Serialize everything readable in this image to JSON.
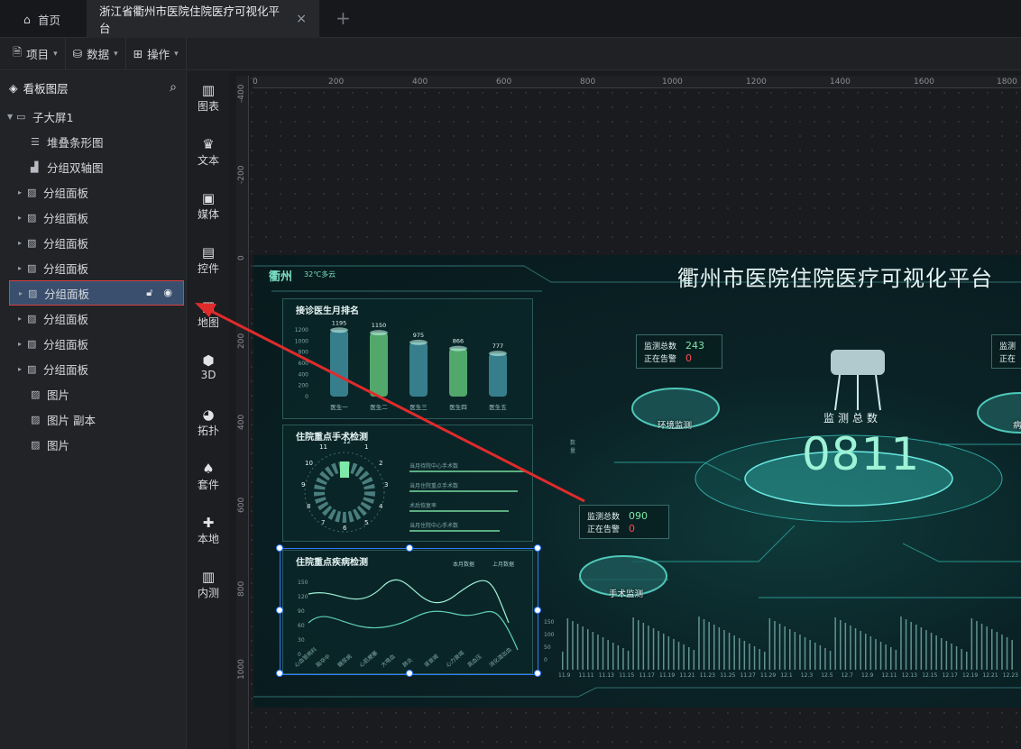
{
  "tabs": {
    "home_label": "首页",
    "active_label": "浙江省衢州市医院住院医疗可视化平台",
    "close": "×",
    "add": "+"
  },
  "toolbar": {
    "project_label": "项目",
    "data_label": "数据",
    "operate_label": "操作"
  },
  "layers": {
    "title": "看板图层",
    "root_label": "子大屏1",
    "items": [
      {
        "label": "堆叠条形图",
        "icon": "stacked-bar-icon"
      },
      {
        "label": "分组双轴图",
        "icon": "dual-axis-icon"
      },
      {
        "label": "分组面板",
        "icon": "group-panel-icon"
      },
      {
        "label": "分组面板",
        "icon": "group-panel-icon"
      },
      {
        "label": "分组面板",
        "icon": "group-panel-icon"
      },
      {
        "label": "分组面板",
        "icon": "group-panel-icon"
      },
      {
        "label": "分组面板",
        "icon": "group-panel-icon",
        "selected": true
      },
      {
        "label": "分组面板",
        "icon": "group-panel-icon"
      },
      {
        "label": "分组面板",
        "icon": "group-panel-icon"
      },
      {
        "label": "分组面板",
        "icon": "group-panel-icon"
      },
      {
        "label": "图片",
        "icon": "image-icon"
      },
      {
        "label": "图片 副本",
        "icon": "image-icon"
      },
      {
        "label": "图片",
        "icon": "image-icon"
      }
    ]
  },
  "components": [
    "图表",
    "文本",
    "媒体",
    "控件",
    "地图",
    "3D",
    "拓扑",
    "套件",
    "本地",
    "内测"
  ],
  "ruler": {
    "top": [
      "0",
      "200",
      "400",
      "600",
      "800",
      "1000",
      "1200",
      "1400",
      "1600",
      "1800"
    ],
    "left": [
      "-400",
      "-200",
      "0",
      "200",
      "400",
      "600",
      "800",
      "1000"
    ]
  },
  "dashboard": {
    "city": "衢州",
    "weather": "32℃多云",
    "title": "衢州市医院住院医疗可视化平台",
    "doctor_panel": {
      "title": "接诊医生月排名",
      "y_ticks": [
        "1200",
        "1000",
        "800",
        "600",
        "400",
        "200",
        "0"
      ]
    },
    "surgery_panel": {
      "title": "住院重点手术检测",
      "clock": [
        "12",
        "1",
        "2",
        "3",
        "4",
        "5",
        "6",
        "7",
        "8",
        "9",
        "10",
        "11"
      ],
      "bar_labels": [
        "当月待院中心手术数",
        "当月住院重点手术数",
        "术后恢复率",
        "当月住院中心手术数",
        "数量"
      ]
    },
    "disease_panel": {
      "title": "住院重点疾病检测",
      "legend": [
        "本月数据",
        "上月数据"
      ],
      "y_ticks": [
        "150",
        "120",
        "90",
        "60",
        "30",
        "0"
      ],
      "x_labels": [
        "心血管病科",
        "脑卒中",
        "糖尿病",
        "心肌梗塞",
        "大咯血",
        "肺炎",
        "肾衰竭",
        "心力衰竭",
        "高血压",
        "消化道出血"
      ]
    },
    "stat_labels": {
      "total": "监测总数",
      "alarm": "正在告警"
    },
    "env": {
      "total": "243",
      "alarm": "0",
      "label": "环境监测"
    },
    "surgery": {
      "total": "090",
      "alarm": "0",
      "label": "手术监测"
    },
    "center": {
      "label": "监测总数",
      "value": "0811"
    },
    "right_cut": {
      "total": "监测",
      "alarm": "正在",
      "label": "病"
    },
    "timeline_y": [
      "150",
      "100",
      "50",
      "0"
    ],
    "timeline_dates": [
      "11.9",
      "11.11",
      "11.13",
      "11.15",
      "11.17",
      "11.19",
      "11.21",
      "11.23",
      "11.25",
      "11.27",
      "11.29",
      "12.1",
      "12.3",
      "12.5",
      "12.7",
      "12.9",
      "12.11",
      "12.13",
      "12.15",
      "12.17",
      "12.19",
      "12.21",
      "12.23"
    ]
  },
  "chart_data": {
    "type": "bar",
    "title": "接诊医生月排名",
    "categories": [
      "医生一",
      "医生二",
      "医生三",
      "医生四",
      "医生五"
    ],
    "values": [
      1195,
      1150,
      975,
      866,
      777
    ],
    "ylim": [
      0,
      1200
    ],
    "colors": [
      "#3f8ea0",
      "#5fbf78",
      "#3f8ea0",
      "#5fbf78",
      "#3f8ea0"
    ]
  }
}
